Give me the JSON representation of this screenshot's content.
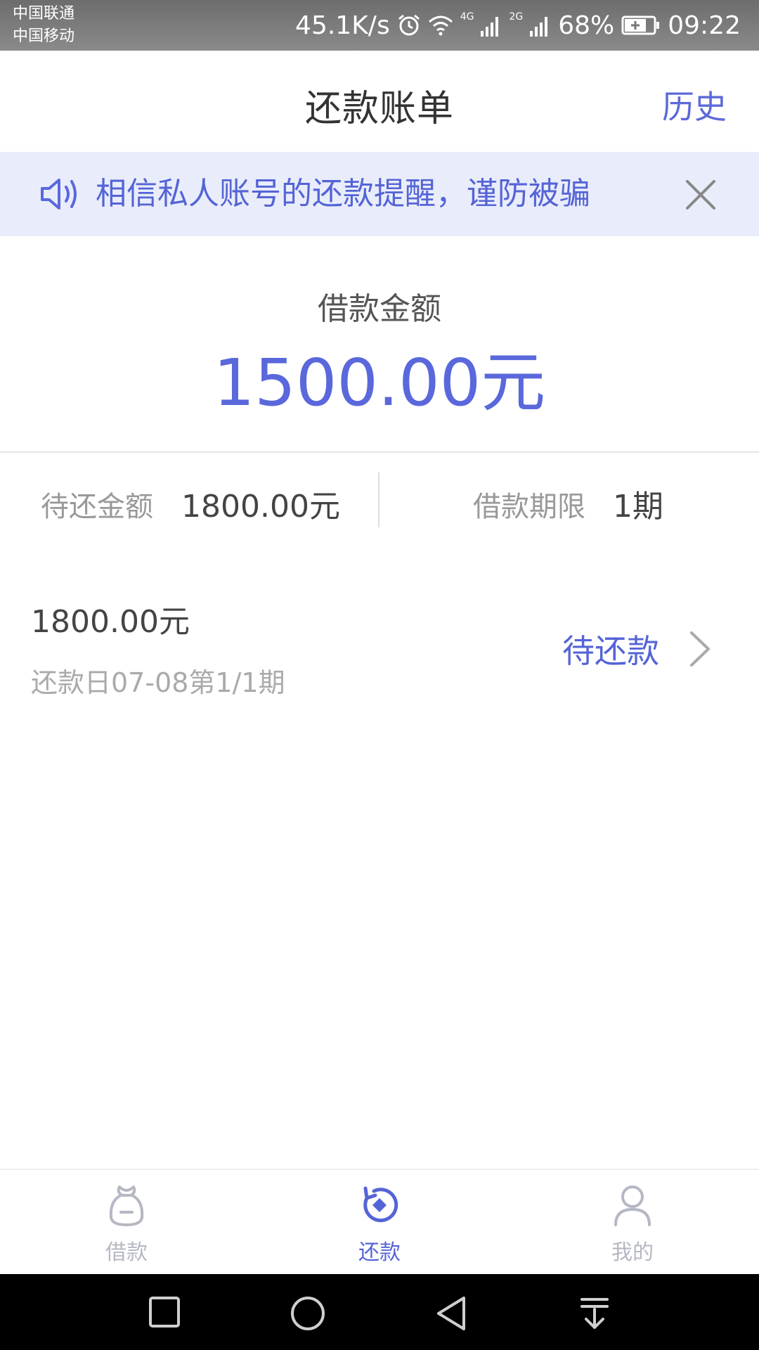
{
  "status_bar": {
    "carrier_1": "中国联通",
    "carrier_2": "中国移动",
    "network_speed": "45.1K/s",
    "network_4g": "4G",
    "network_2g": "2G",
    "battery": "68%",
    "time": "09:22"
  },
  "header": {
    "title": "还款账单",
    "history": "历史"
  },
  "notice": {
    "text": "相信私人账号的还款提醒，谨防被骗"
  },
  "loan": {
    "label": "借款金额",
    "amount": "1500.00元"
  },
  "summary": {
    "due_label": "待还金额",
    "due_value": "1800.00元",
    "term_label": "借款期限",
    "term_value": "1期"
  },
  "bill": {
    "amount": "1800.00元",
    "date": "还款日07-08第1/1期",
    "status": "待还款"
  },
  "tabs": [
    {
      "label": "借款",
      "icon": "loan-bag-icon"
    },
    {
      "label": "还款",
      "icon": "repay-icon"
    },
    {
      "label": "我的",
      "icon": "user-icon"
    }
  ],
  "colors": {
    "accent": "#5a68dc",
    "notice_bg": "#e9edfb",
    "tab_inactive": "#b5b8c2"
  }
}
